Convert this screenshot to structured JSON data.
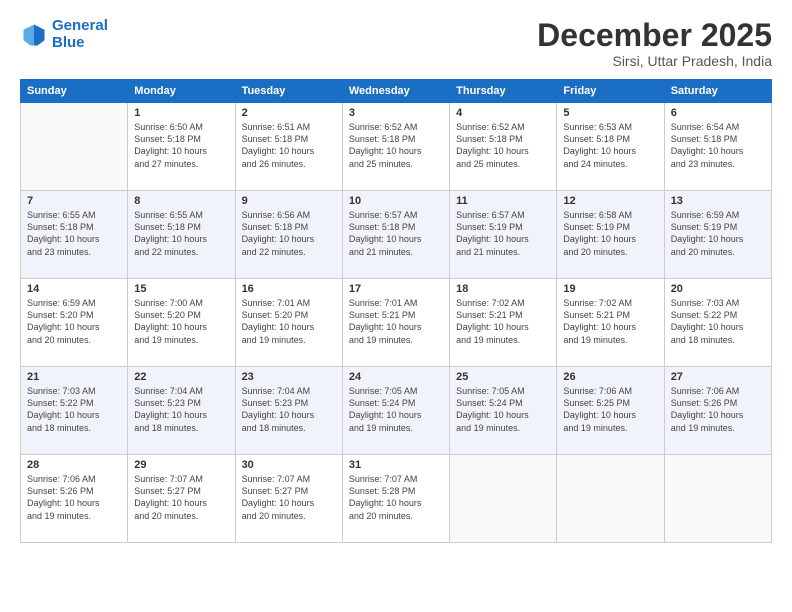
{
  "logo": {
    "line1": "General",
    "line2": "Blue"
  },
  "title": "December 2025",
  "subtitle": "Sirsi, Uttar Pradesh, India",
  "weekdays": [
    "Sunday",
    "Monday",
    "Tuesday",
    "Wednesday",
    "Thursday",
    "Friday",
    "Saturday"
  ],
  "weeks": [
    [
      {
        "day": "",
        "info": ""
      },
      {
        "day": "1",
        "info": "Sunrise: 6:50 AM\nSunset: 5:18 PM\nDaylight: 10 hours\nand 27 minutes."
      },
      {
        "day": "2",
        "info": "Sunrise: 6:51 AM\nSunset: 5:18 PM\nDaylight: 10 hours\nand 26 minutes."
      },
      {
        "day": "3",
        "info": "Sunrise: 6:52 AM\nSunset: 5:18 PM\nDaylight: 10 hours\nand 25 minutes."
      },
      {
        "day": "4",
        "info": "Sunrise: 6:52 AM\nSunset: 5:18 PM\nDaylight: 10 hours\nand 25 minutes."
      },
      {
        "day": "5",
        "info": "Sunrise: 6:53 AM\nSunset: 5:18 PM\nDaylight: 10 hours\nand 24 minutes."
      },
      {
        "day": "6",
        "info": "Sunrise: 6:54 AM\nSunset: 5:18 PM\nDaylight: 10 hours\nand 23 minutes."
      }
    ],
    [
      {
        "day": "7",
        "info": "Sunrise: 6:55 AM\nSunset: 5:18 PM\nDaylight: 10 hours\nand 23 minutes."
      },
      {
        "day": "8",
        "info": "Sunrise: 6:55 AM\nSunset: 5:18 PM\nDaylight: 10 hours\nand 22 minutes."
      },
      {
        "day": "9",
        "info": "Sunrise: 6:56 AM\nSunset: 5:18 PM\nDaylight: 10 hours\nand 22 minutes."
      },
      {
        "day": "10",
        "info": "Sunrise: 6:57 AM\nSunset: 5:18 PM\nDaylight: 10 hours\nand 21 minutes."
      },
      {
        "day": "11",
        "info": "Sunrise: 6:57 AM\nSunset: 5:19 PM\nDaylight: 10 hours\nand 21 minutes."
      },
      {
        "day": "12",
        "info": "Sunrise: 6:58 AM\nSunset: 5:19 PM\nDaylight: 10 hours\nand 20 minutes."
      },
      {
        "day": "13",
        "info": "Sunrise: 6:59 AM\nSunset: 5:19 PM\nDaylight: 10 hours\nand 20 minutes."
      }
    ],
    [
      {
        "day": "14",
        "info": "Sunrise: 6:59 AM\nSunset: 5:20 PM\nDaylight: 10 hours\nand 20 minutes."
      },
      {
        "day": "15",
        "info": "Sunrise: 7:00 AM\nSunset: 5:20 PM\nDaylight: 10 hours\nand 19 minutes."
      },
      {
        "day": "16",
        "info": "Sunrise: 7:01 AM\nSunset: 5:20 PM\nDaylight: 10 hours\nand 19 minutes."
      },
      {
        "day": "17",
        "info": "Sunrise: 7:01 AM\nSunset: 5:21 PM\nDaylight: 10 hours\nand 19 minutes."
      },
      {
        "day": "18",
        "info": "Sunrise: 7:02 AM\nSunset: 5:21 PM\nDaylight: 10 hours\nand 19 minutes."
      },
      {
        "day": "19",
        "info": "Sunrise: 7:02 AM\nSunset: 5:21 PM\nDaylight: 10 hours\nand 19 minutes."
      },
      {
        "day": "20",
        "info": "Sunrise: 7:03 AM\nSunset: 5:22 PM\nDaylight: 10 hours\nand 18 minutes."
      }
    ],
    [
      {
        "day": "21",
        "info": "Sunrise: 7:03 AM\nSunset: 5:22 PM\nDaylight: 10 hours\nand 18 minutes."
      },
      {
        "day": "22",
        "info": "Sunrise: 7:04 AM\nSunset: 5:23 PM\nDaylight: 10 hours\nand 18 minutes."
      },
      {
        "day": "23",
        "info": "Sunrise: 7:04 AM\nSunset: 5:23 PM\nDaylight: 10 hours\nand 18 minutes."
      },
      {
        "day": "24",
        "info": "Sunrise: 7:05 AM\nSunset: 5:24 PM\nDaylight: 10 hours\nand 19 minutes."
      },
      {
        "day": "25",
        "info": "Sunrise: 7:05 AM\nSunset: 5:24 PM\nDaylight: 10 hours\nand 19 minutes."
      },
      {
        "day": "26",
        "info": "Sunrise: 7:06 AM\nSunset: 5:25 PM\nDaylight: 10 hours\nand 19 minutes."
      },
      {
        "day": "27",
        "info": "Sunrise: 7:06 AM\nSunset: 5:26 PM\nDaylight: 10 hours\nand 19 minutes."
      }
    ],
    [
      {
        "day": "28",
        "info": "Sunrise: 7:06 AM\nSunset: 5:26 PM\nDaylight: 10 hours\nand 19 minutes."
      },
      {
        "day": "29",
        "info": "Sunrise: 7:07 AM\nSunset: 5:27 PM\nDaylight: 10 hours\nand 20 minutes."
      },
      {
        "day": "30",
        "info": "Sunrise: 7:07 AM\nSunset: 5:27 PM\nDaylight: 10 hours\nand 20 minutes."
      },
      {
        "day": "31",
        "info": "Sunrise: 7:07 AM\nSunset: 5:28 PM\nDaylight: 10 hours\nand 20 minutes."
      },
      {
        "day": "",
        "info": ""
      },
      {
        "day": "",
        "info": ""
      },
      {
        "day": "",
        "info": ""
      }
    ]
  ]
}
